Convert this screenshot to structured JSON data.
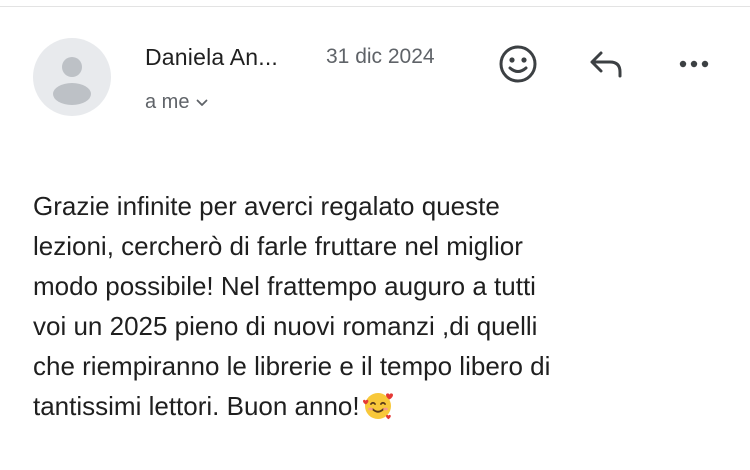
{
  "header": {
    "sender_name": "Daniela An...",
    "date": "31 dic 2024",
    "recipient": "a me",
    "icons": {
      "avatar": "person-avatar",
      "emoji": "emoji-reaction-icon",
      "reply": "reply-arrow-icon",
      "more": "more-horizontal-icon",
      "recipient_chevron": "chevron-down-icon"
    }
  },
  "message": {
    "body": "Grazie infinite per averci regalato queste\nlezioni, cercherò di farle fruttare nel miglior\nmodo possibile! Nel frattempo auguro a tutti\nvoi un 2025 pieno di nuovi romanzi ,di quelli\nche riempiranno le librerie e il tempo libero di\ntantissimi lettori. Buon anno!",
    "trailing_emoji": "smiling-face-with-hearts"
  },
  "colors": {
    "text": "#1f1f1f",
    "muted": "#5f6368",
    "avatar_bg": "#e8eaed",
    "avatar_fg": "#bdc1c6",
    "divider": "#e3e3e3"
  }
}
